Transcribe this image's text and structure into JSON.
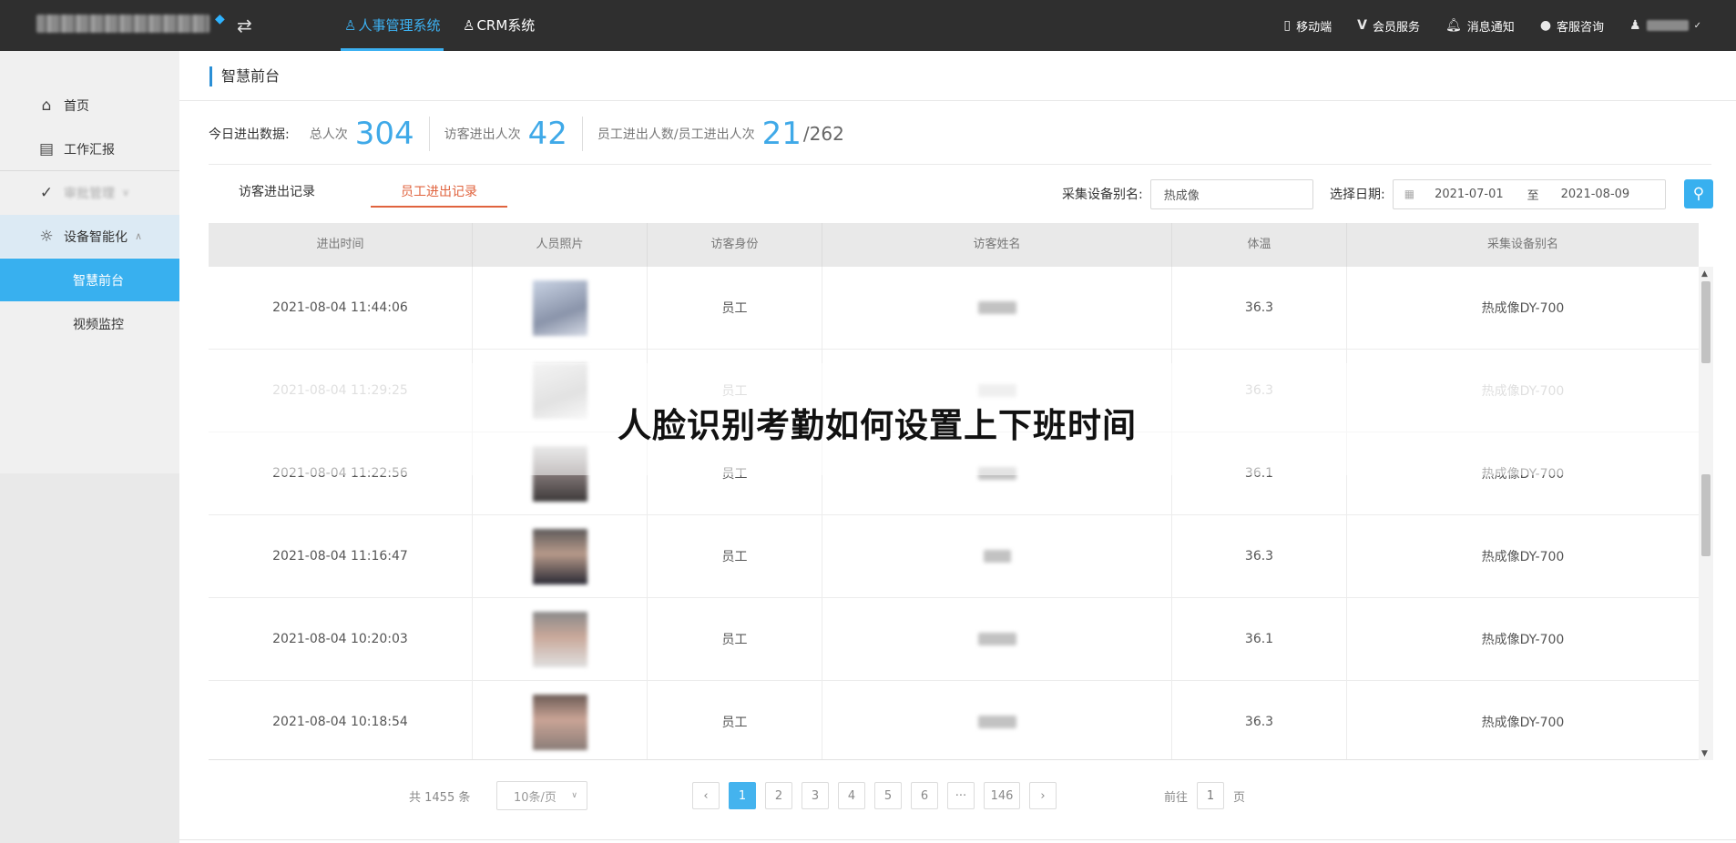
{
  "topbar": {
    "nav_tabs": [
      {
        "label": "人事管理系统",
        "active": true
      },
      {
        "label": "CRM系统",
        "active": false
      }
    ],
    "right_items": [
      {
        "label": "移动端",
        "icon": "mobile-icon"
      },
      {
        "label": "会员服务",
        "icon": "vip-icon"
      },
      {
        "label": "消息通知",
        "icon": "bell-icon"
      },
      {
        "label": "客服咨询",
        "icon": "chat-icon"
      }
    ]
  },
  "sidebar": {
    "items": [
      {
        "label": "首页",
        "icon": "home-icon"
      },
      {
        "label": "工作汇报",
        "icon": "report-icon"
      },
      {
        "label": "审批管理",
        "icon": "check-circle-icon"
      },
      {
        "label": "设备智能化",
        "icon": "bulb-icon"
      }
    ],
    "sub_items": [
      {
        "label": "智慧前台",
        "active": true
      },
      {
        "label": "视频监控",
        "active": false
      }
    ]
  },
  "page": {
    "title": "智慧前台"
  },
  "stats": {
    "heading": "今日进出数据:",
    "total_label": "总人次",
    "total_value": "304",
    "visitor_label": "访客进出人次",
    "visitor_value": "42",
    "staff_label": "员工进出人数/员工进出人次",
    "staff_value": "21",
    "staff_total": "/262"
  },
  "tabs": [
    {
      "label": "访客进出记录",
      "active": false
    },
    {
      "label": "员工进出记录",
      "active": true
    }
  ],
  "filters": {
    "device_label": "采集设备别名:",
    "device_value": "热成像",
    "date_label": "选择日期:",
    "date_start": "2021-07-01",
    "date_sep": "至",
    "date_end": "2021-08-09"
  },
  "table": {
    "columns": [
      "进出时间",
      "人员照片",
      "访客身份",
      "访客姓名",
      "体温",
      "采集设备别名"
    ],
    "rows": [
      {
        "time": "2021-08-04 11:44:06",
        "identity": "员工",
        "temp": "36.3",
        "device": "热成像DY-700"
      },
      {
        "time": "2021-08-04 11:29:25",
        "identity": "员工",
        "temp": "36.3",
        "device": "热成像DY-700"
      },
      {
        "time": "2021-08-04 11:22:56",
        "identity": "员工",
        "temp": "36.1",
        "device": "热成像DY-700"
      },
      {
        "time": "2021-08-04 11:16:47",
        "identity": "员工",
        "temp": "36.3",
        "device": "热成像DY-700"
      },
      {
        "time": "2021-08-04 10:20:03",
        "identity": "员工",
        "temp": "36.1",
        "device": "热成像DY-700"
      },
      {
        "time": "2021-08-04 10:18:54",
        "identity": "员工",
        "temp": "36.3",
        "device": "热成像DY-700"
      }
    ]
  },
  "overlay": {
    "caption": "人脸识别考勤如何设置上下班时间"
  },
  "pagination": {
    "total_text": "共 1455 条",
    "page_size": "10条/页",
    "pages": [
      "1",
      "2",
      "3",
      "4",
      "5",
      "6",
      "···",
      "146"
    ],
    "current": "1",
    "goto_label": "前往",
    "goto_value": "1",
    "goto_suffix": "页"
  },
  "colors": {
    "accent": "#38b0ef",
    "active_tab": "#e0633e",
    "topbar_bg": "#2f2f2f"
  }
}
